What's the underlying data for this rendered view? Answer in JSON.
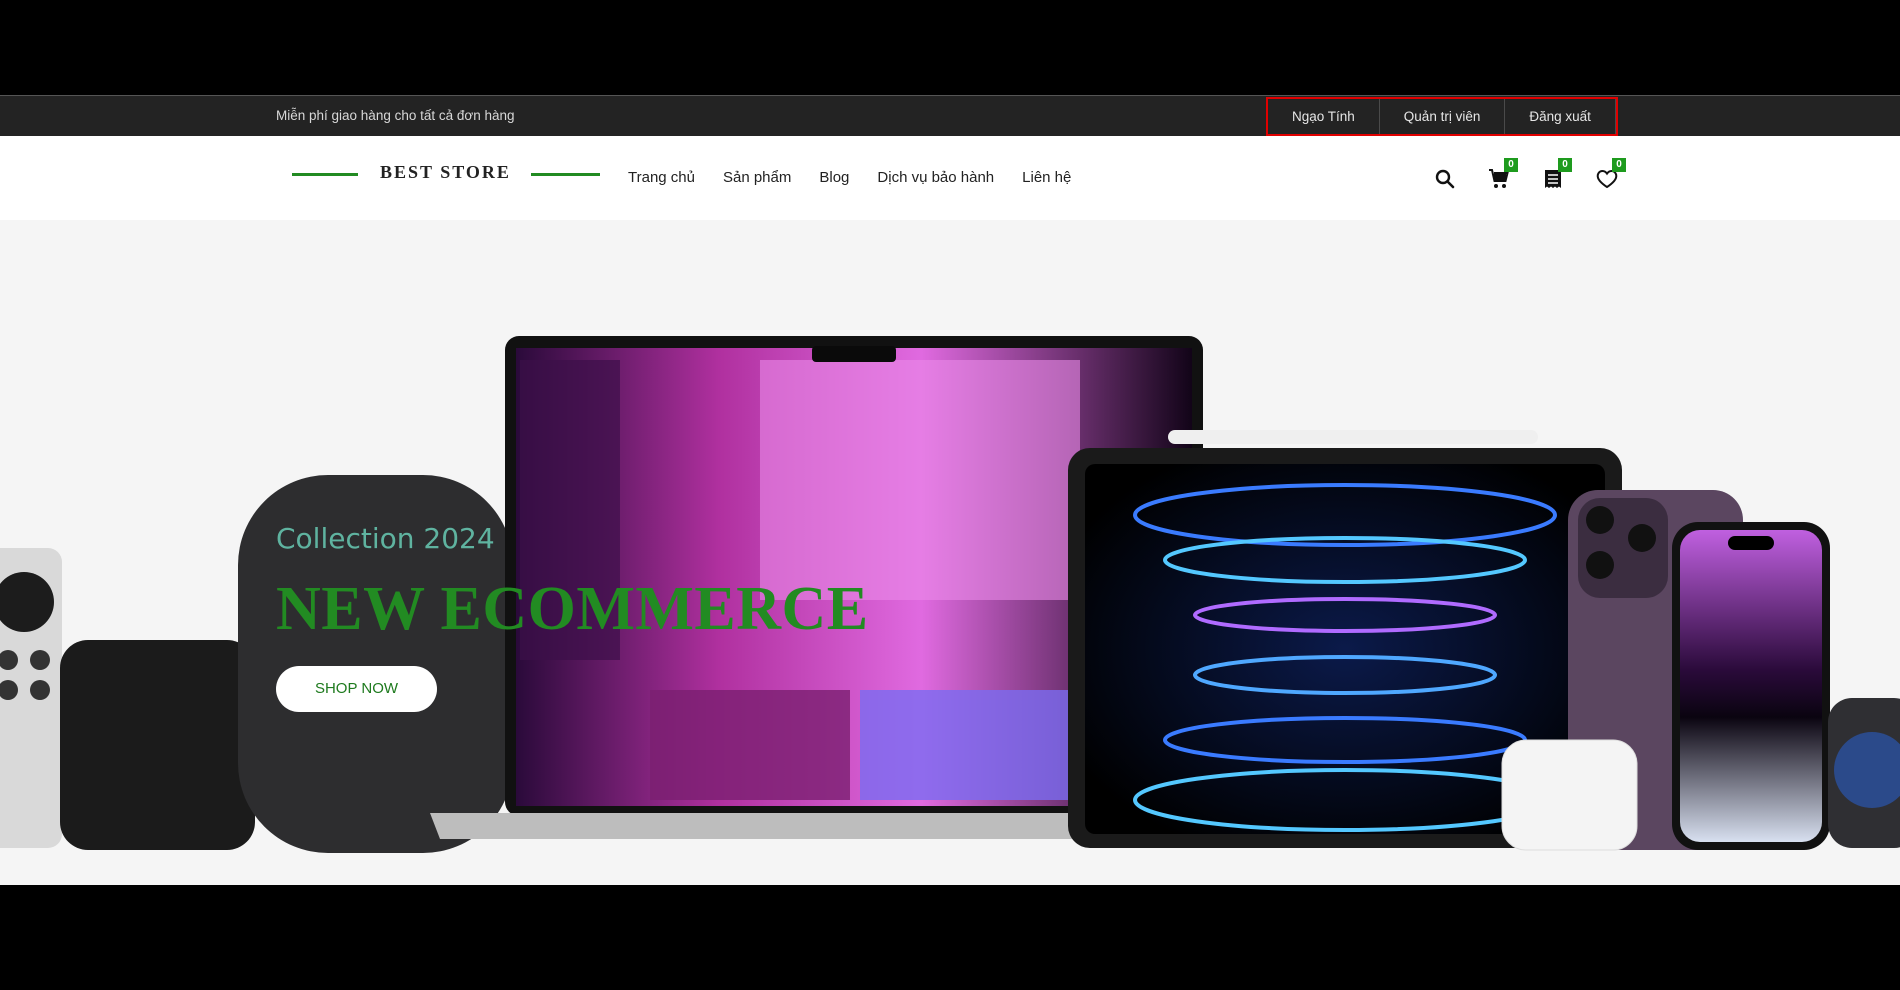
{
  "topbar": {
    "promo": "Miễn phí giao hàng cho tất cả đơn hàng",
    "links": [
      "Ngạo Tính",
      "Quản trị viên",
      "Đăng xuất"
    ]
  },
  "header": {
    "logo": "BEST STORE",
    "nav": [
      "Trang chủ",
      "Sản phẩm",
      "Blog",
      "Dịch vụ bảo hành",
      "Liên hệ"
    ],
    "icons": [
      {
        "name": "search-icon"
      },
      {
        "name": "cart-icon",
        "badge": "0"
      },
      {
        "name": "orders-icon",
        "badge": "0"
      },
      {
        "name": "heart-icon",
        "badge": "0"
      }
    ],
    "accent": "#228b22"
  },
  "hero": {
    "subtitle": "Collection 2024",
    "title": "NEW ECOMMERCE",
    "button": "SHOP NOW"
  }
}
